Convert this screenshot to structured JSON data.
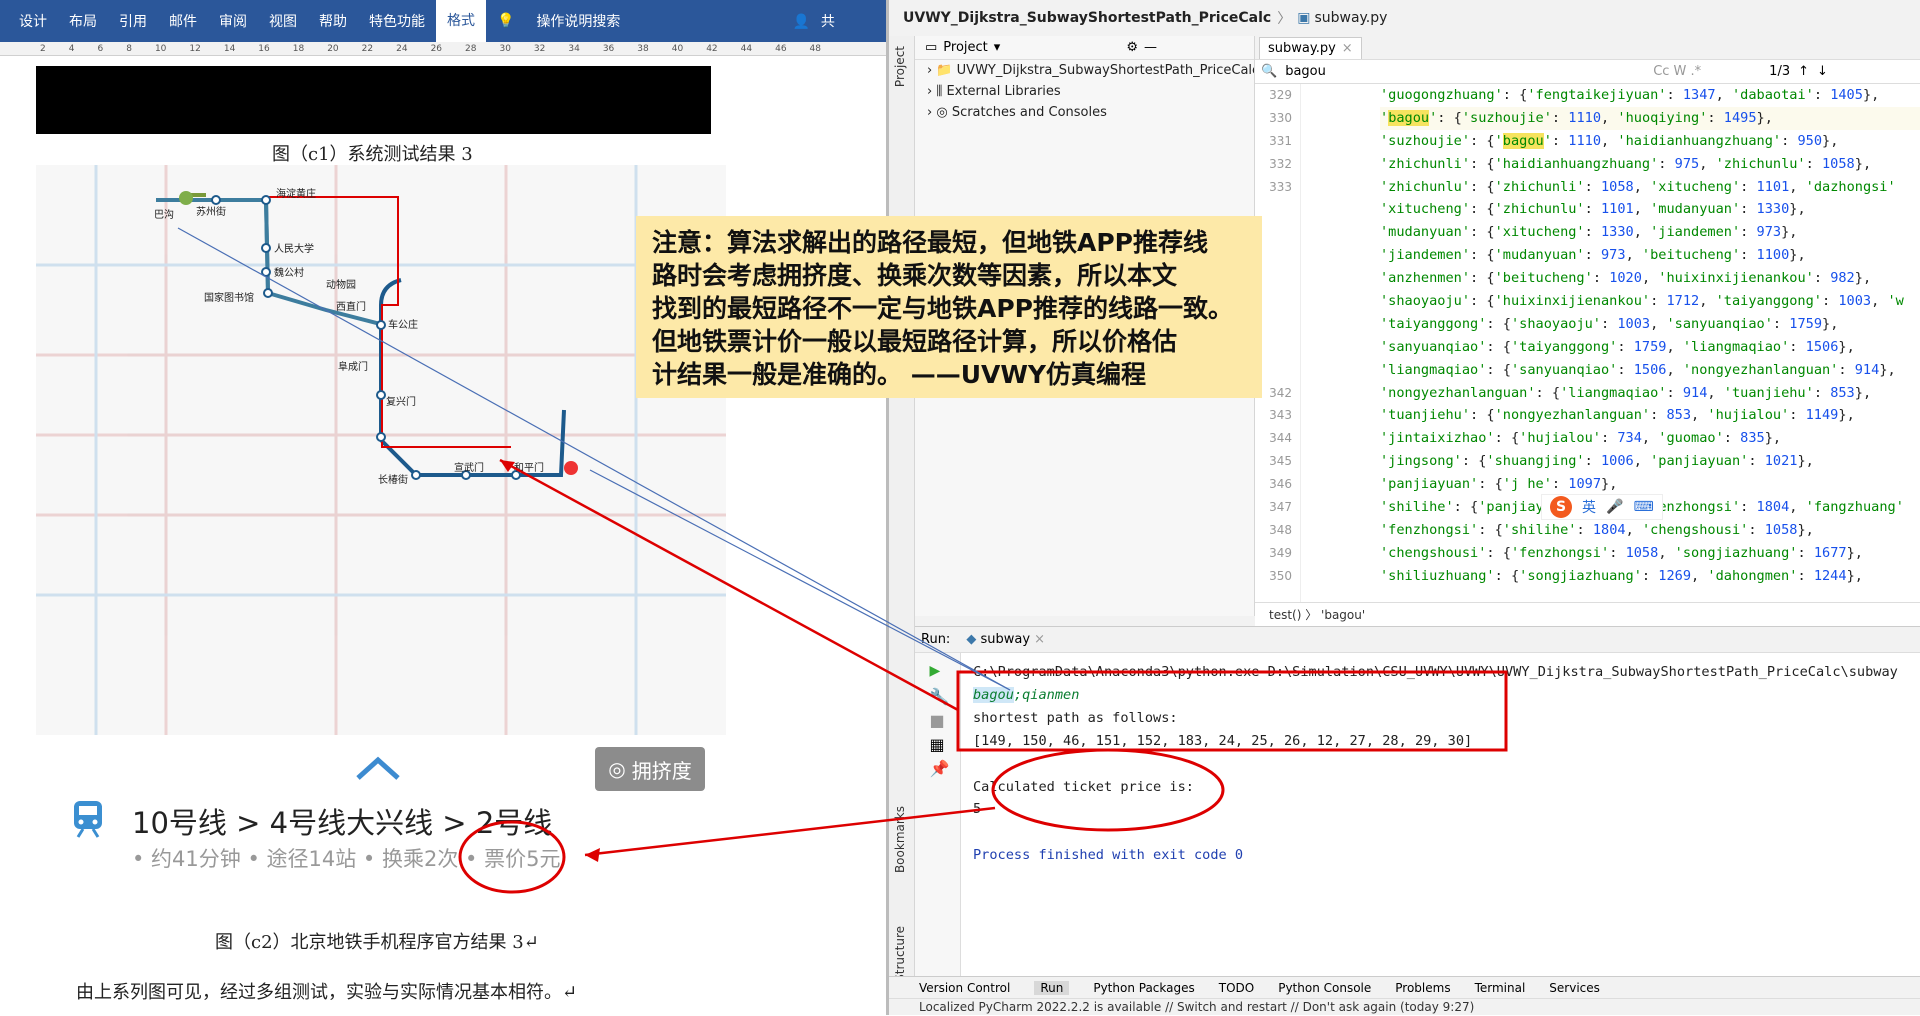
{
  "word": {
    "ribbon_tabs": [
      "设计",
      "布局",
      "引用",
      "邮件",
      "审阅",
      "视图",
      "帮助",
      "特色功能",
      "格式"
    ],
    "ribbon_active": "格式",
    "search_label": "操作说明搜索",
    "share_label": "共",
    "ruler_ticks": [
      "2",
      "4",
      "6",
      "8",
      "10",
      "12",
      "14",
      "16",
      "18",
      "20",
      "22",
      "24",
      "26",
      "28",
      "30",
      "32",
      "34",
      "36",
      "38",
      "40",
      "42",
      "44",
      "46",
      "48"
    ],
    "caption_c1": "图（c1）系统测试结果 3",
    "map_stations": [
      "巴沟",
      "苏州街",
      "海淀黄庄",
      "人民大学",
      "魏公村",
      "国家图书馆",
      "动物园",
      "西直门",
      "车公庄",
      "阜成门",
      "复兴门",
      "长椿街",
      "宣武门",
      "和平门"
    ],
    "route_title": "10号线 > 4号线大兴线 > 2号线",
    "route_sub": "• 约41分钟 • 途径14站 • 换乘2次 • 票价5元",
    "crowd_button": "拥挤度",
    "caption_c2": "图（c2）北京地铁手机程序官方结果 3↵",
    "body_text": "由上系列图可见，经过多组测试，实验与实际情况基本相符。↵"
  },
  "note": {
    "lines": [
      "注意：算法求解出的路径最短，但地铁APP推荐线",
      "路时会考虑拥挤度、换乘次数等因素，所以本文",
      "找到的最短路径不一定与地铁APP推荐的线路一致。",
      "但地铁票计价一般以最短路径计算，所以价格估",
      "计结果一般是准确的。 ——UVWY仿真编程"
    ]
  },
  "ide": {
    "title_project": "UVWY_Dijkstra_SubwayShortestPath_PriceCalc",
    "title_file": "subway.py",
    "project_label": "Project",
    "tree": [
      "UVWY_Dijkstra_SubwayShortestPath_PriceCalc [D",
      "External Libraries",
      "Scratches and Consoles"
    ],
    "editor_tab": "subway.py",
    "find_value": "bagou",
    "find_count": "1/3",
    "line_numbers": [
      "329",
      "330",
      "331",
      "332",
      "333",
      "",
      "",
      "",
      "",
      "",
      "",
      "",
      "",
      "342",
      "343",
      "344",
      "345",
      "346",
      "347",
      "348",
      "349",
      "350"
    ],
    "code_lines": [
      "'guogongzhuang': {'fengtaikejiyuan': 1347, 'dabaotai': 1405},",
      "'bagou': {'suzhoujie': 1110, 'huoqiying': 1495},",
      "'suzhoujie': {'bagou': 1110, 'haidianhuangzhuang': 950},",
      "'zhichunli': {'haidianhuangzhuang': 975, 'zhichunlu': 1058},",
      "'zhichunlu': {'zhichunli': 1058, 'xitucheng': 1101, 'dazhongsi'",
      "'xitucheng': {'zhichunlu': 1101, 'mudanyuan': 1330},",
      "'mudanyuan': {'xitucheng': 1330, 'jiandemen': 973},",
      "'jiandemen': {'mudanyuan': 973, 'beitucheng': 1100},",
      "'anzhenmen': {'beitucheng': 1020, 'huixinxijienankou': 982},",
      "'shaoyaoju': {'huixinxijienankou': 1712, 'taiyanggong': 1003, 'w",
      "'taiyanggong': {'shaoyaoju': 1003, 'sanyuanqiao': 1759},",
      "'sanyuanqiao': {'taiyanggong': 1759, 'liangmaqiao': 1506},",
      "'liangmaqiao': {'sanyuanqiao': 1506, 'nongyezhanlanguan': 914},",
      "'nongyezhanlanguan': {'liangmaqiao': 914, 'tuanjiehu': 853},",
      "'tuanjiehu': {'nongyezhanlanguan': 853, 'hujialou': 1149},",
      "'jintaixizhao': {'hujialou': 734, 'guomao': 835},",
      "'jingsong': {'shuangjing': 1006, 'panjiayuan': 1021},",
      "'panjiayuan': {'j            he': 1097},",
      "'shilihe': {'panjiayuan': 1097, 'fenzhongsi': 1804, 'fangzhuang'",
      "'fenzhongsi': {'shilihe': 1804, 'chengshousi': 1058},",
      "'chengshousi': {'fenzhongsi': 1058, 'songjiazhuang': 1677},",
      "'shiliuzhuang': {'songjiazhuang': 1269, 'dahongmen': 1244},"
    ],
    "breadcrumb": "test()  〉 'bagou'",
    "run_label": "Run:",
    "run_tab": "subway",
    "console": {
      "cmd": "C:\\ProgramData\\Anaconda3\\python.exe D:\\Simulation\\CSU_UVWY\\UVWY\\UVWY_Dijkstra_SubwayShortestPath_PriceCalc\\subway",
      "input_a": "bagou",
      "input_b": ";qianmen",
      "line1": "shortest path as follows:",
      "line2": "[149, 150, 46, 151, 152, 183, 24, 25, 26, 12, 27, 28, 29, 30]",
      "line3": "Calculated ticket price is:",
      "line4": "5",
      "line5": "Process finished with exit code 0"
    },
    "bottom_tools": [
      "Version Control",
      "Run",
      "Python Packages",
      "TODO",
      "Python Console",
      "Problems",
      "Terminal",
      "Services"
    ],
    "status": "Localized PyCharm 2022.2.2 is available // Switch and restart // Don't ask again (today 9:27)",
    "side_labels": [
      "Project",
      "Bookmarks",
      "Structure"
    ],
    "ime_label": "英"
  }
}
